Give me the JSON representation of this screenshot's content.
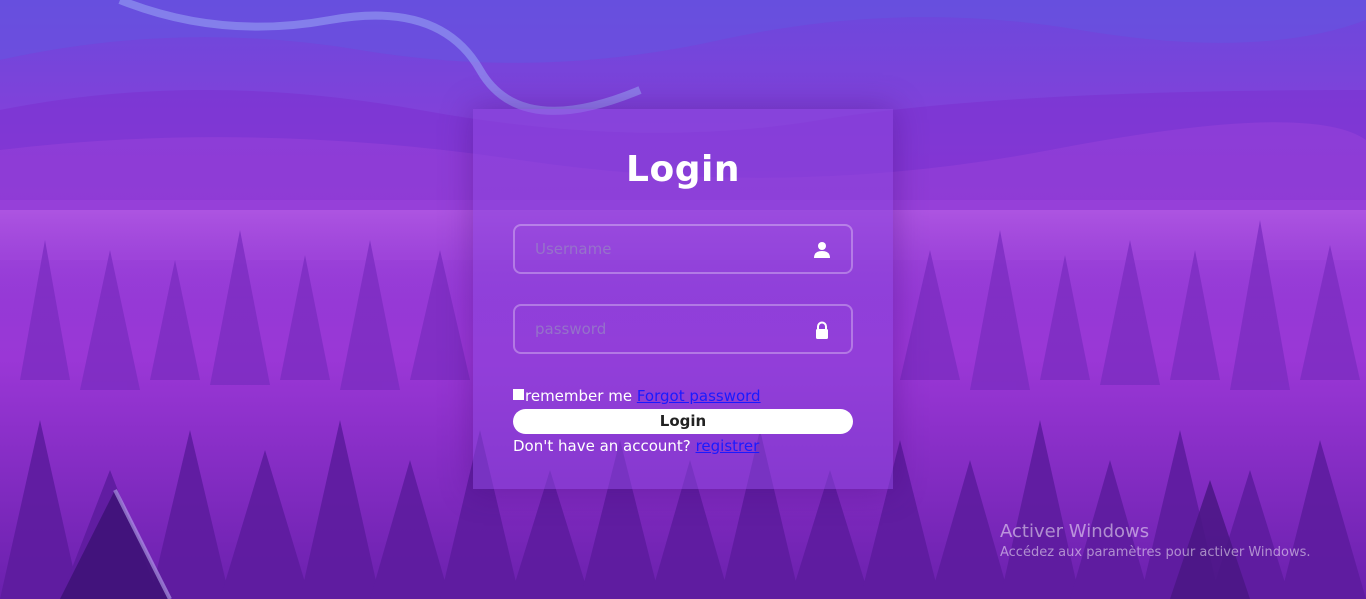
{
  "colors": {
    "accent": "#8a3fd8",
    "card": "rgba(140, 70, 220, 0.55)",
    "link": "#1a1aff",
    "button_bg": "#ffffff"
  },
  "login_form": {
    "title": "Login",
    "username": {
      "value": "",
      "placeholder": "Username",
      "icon": "user-icon"
    },
    "password": {
      "value": "",
      "placeholder": "password",
      "icon": "lock-icon"
    },
    "remember_label": "remember me",
    "remember_checked": false,
    "forgot_link": "Forgot password",
    "submit_label": "Login",
    "register_prompt": "Don't have an account?",
    "register_link": "registrer"
  },
  "watermark": {
    "title": "Activer Windows",
    "subtitle": "Accédez aux paramètres pour activer Windows."
  }
}
